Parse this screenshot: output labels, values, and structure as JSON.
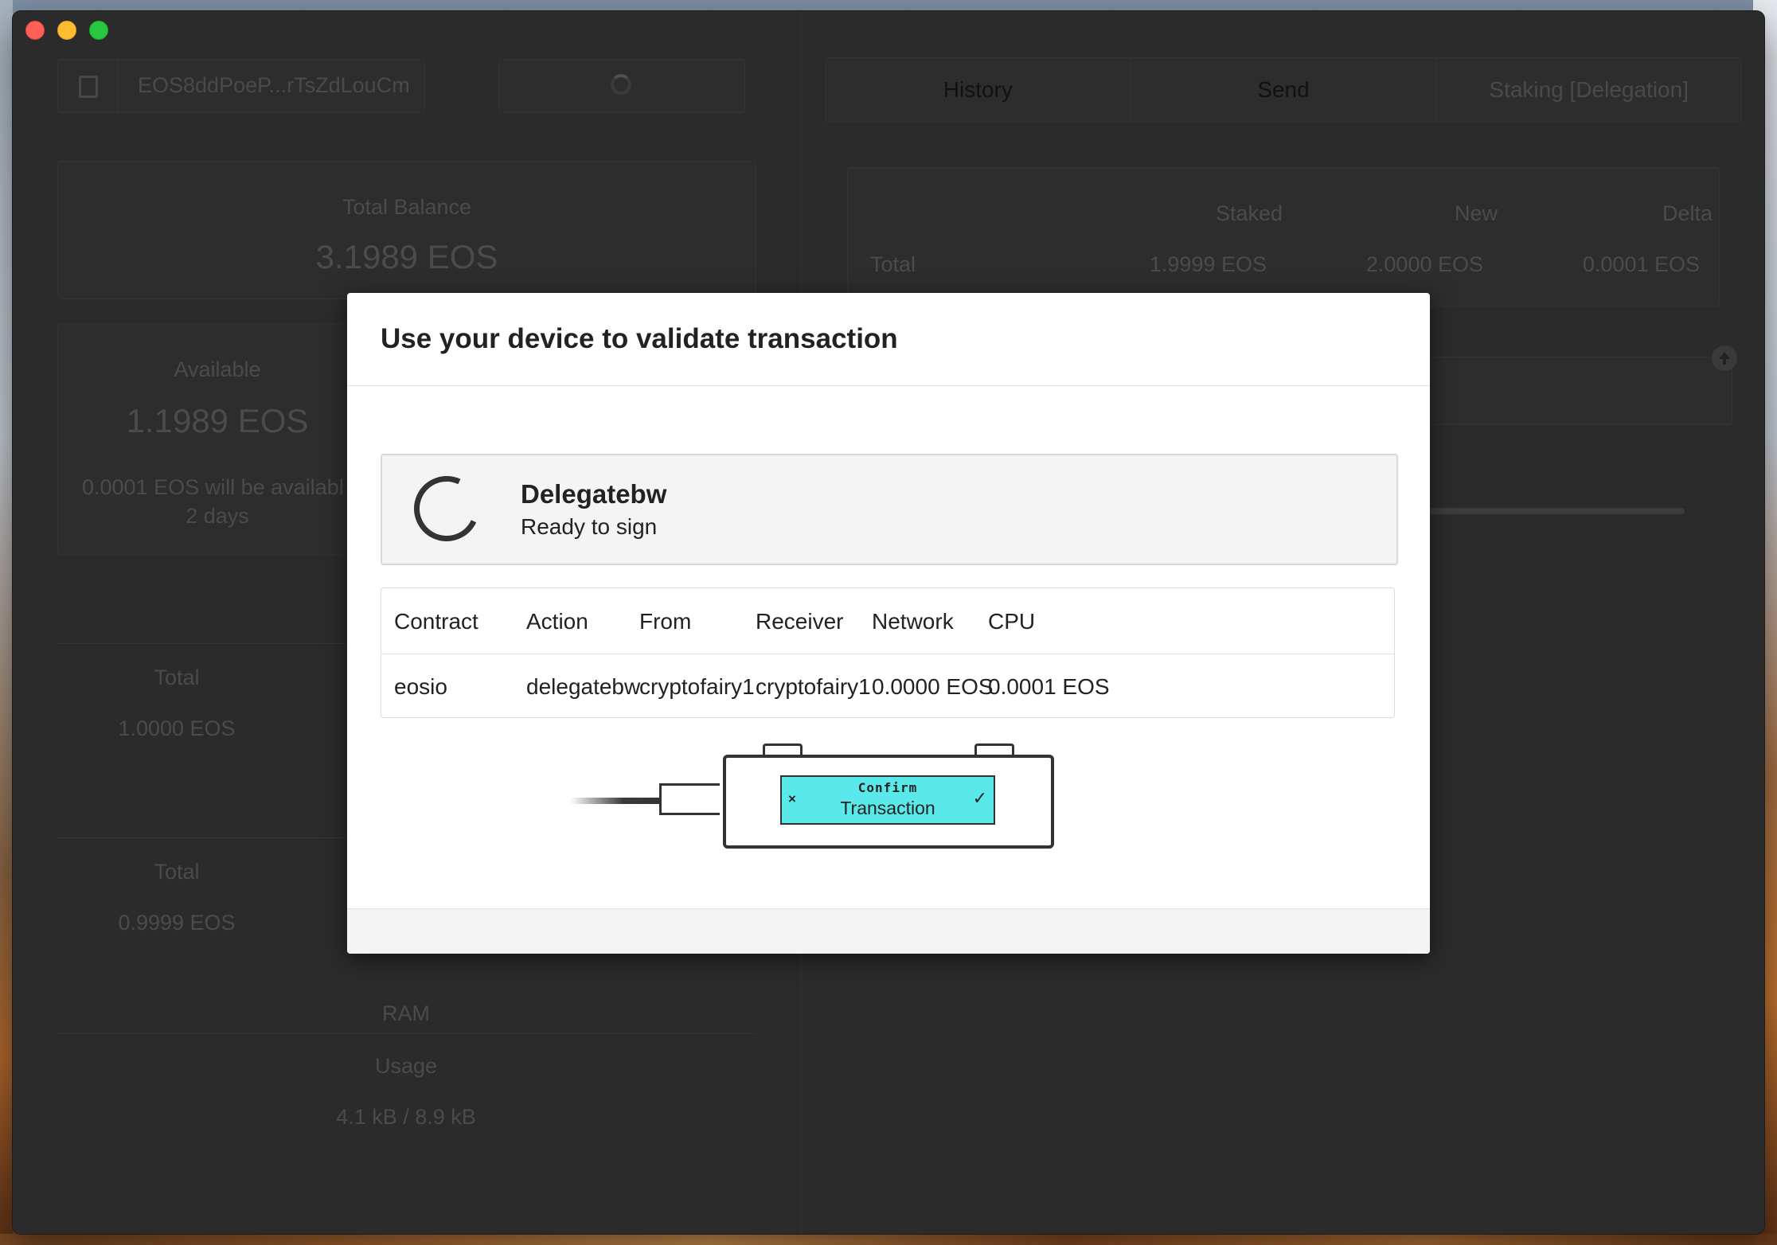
{
  "wallet": {
    "address": "EOS8ddPoeP...rTsZdLouCm",
    "total_balance_label": "Total Balance",
    "total_balance": "3.1989 EOS",
    "available_label": "Available",
    "available": "1.1989 EOS",
    "available_note_line1": "0.0001 EOS will be availabl",
    "available_note_line2": "2 days",
    "cpu_total_label": "Total",
    "cpu_total": "1.0000 EOS",
    "net_total_label": "Total",
    "net_total": "0.9999 EOS",
    "ram_label": "RAM",
    "ram_usage_label": "Usage",
    "ram_usage": "4.1 kB / 8.9 kB"
  },
  "tabs": [
    {
      "label": "History"
    },
    {
      "label": "Send"
    },
    {
      "label": "Staking [Delegation]"
    }
  ],
  "staking_summary": {
    "headers": [
      "Staked",
      "New",
      "Delta"
    ],
    "row_label": "Total",
    "values": [
      "1.9999 EOS",
      "2.0000 EOS",
      "0.0001 EOS"
    ]
  },
  "modal": {
    "title": "Use your device to validate transaction",
    "status_title": "Delegatebw",
    "status_subtitle": "Ready to sign",
    "table": {
      "headers": [
        "Contract",
        "Action",
        "From",
        "Receiver",
        "Network",
        "CPU"
      ],
      "row": [
        "eosio",
        "delegatebw",
        "cryptofairy1",
        "cryptofairy1",
        "0.0000 EOS",
        "0.0001 EOS"
      ]
    },
    "device_screen": {
      "line1": "Confirm",
      "line2": "Transaction",
      "left_symbol": "×",
      "right_symbol": "✓"
    }
  }
}
